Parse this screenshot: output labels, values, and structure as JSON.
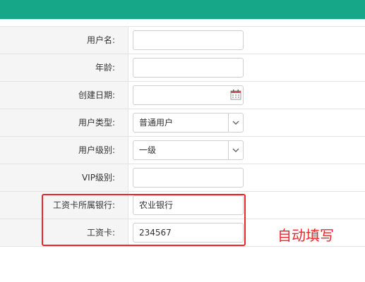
{
  "form": {
    "rows": [
      {
        "label": "用户名:",
        "value": ""
      },
      {
        "label": "年龄:",
        "value": ""
      },
      {
        "label": "创建日期:",
        "value": ""
      },
      {
        "label": "用户类型:",
        "value": "普通用户"
      },
      {
        "label": "用户级别:",
        "value": "一级"
      },
      {
        "label": "VIP级别:",
        "value": ""
      },
      {
        "label": "工资卡所属银行:",
        "value": "农业银行"
      },
      {
        "label": "工资卡:",
        "value": "234567"
      }
    ]
  },
  "annotation": {
    "text": "自动填写"
  },
  "colors": {
    "topbar": "#16a688",
    "annotation": "#e8262b"
  }
}
